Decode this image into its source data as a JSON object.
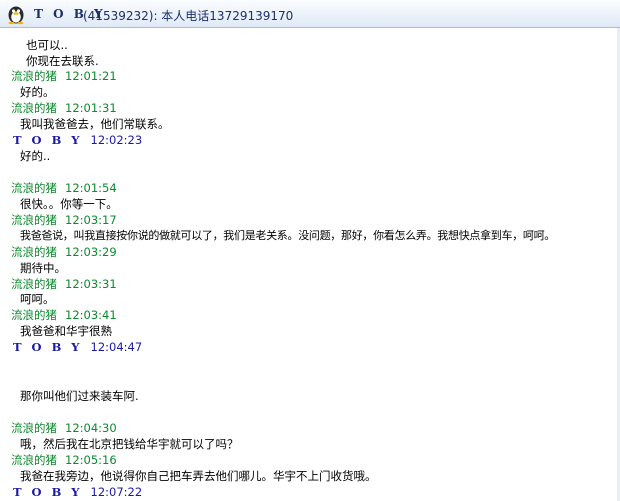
{
  "window": {
    "contact_name": "T O B Y",
    "contact_info": "(41539232): 本人电话13729139170"
  },
  "messages": [
    {
      "type": "text",
      "text": "也可以.."
    },
    {
      "type": "text",
      "text": "你现在去联系."
    },
    {
      "type": "header",
      "sender": "流浪的猪",
      "time": "12:01:21",
      "color": "green"
    },
    {
      "type": "text",
      "text": "好的。"
    },
    {
      "type": "header",
      "sender": "流浪的猪",
      "time": "12:01:31",
      "color": "green"
    },
    {
      "type": "text",
      "text": "我叫我爸爸去，他们常联系。"
    },
    {
      "type": "header",
      "sender": "T O B Y",
      "time": "12:02:23",
      "color": "blue"
    },
    {
      "type": "text",
      "text": "好的.."
    },
    {
      "type": "header",
      "sender": "流浪的猪",
      "time": "12:01:54",
      "color": "green"
    },
    {
      "type": "text",
      "text": "很快。。你等一下。"
    },
    {
      "type": "header",
      "sender": "流浪的猪",
      "time": "12:03:17",
      "color": "green"
    },
    {
      "type": "text",
      "text": "我爸爸说，叫我直接按你说的做就可以了，我们是老关系。没问题，那好，你看怎么弄。我想快点拿到车，呵呵。"
    },
    {
      "type": "header",
      "sender": "流浪的猪",
      "time": "12:03:29",
      "color": "green"
    },
    {
      "type": "text",
      "text": "期待中。"
    },
    {
      "type": "header",
      "sender": "流浪的猪",
      "time": "12:03:31",
      "color": "green"
    },
    {
      "type": "text",
      "text": "呵呵。"
    },
    {
      "type": "header",
      "sender": "流浪的猪",
      "time": "12:03:41",
      "color": "green"
    },
    {
      "type": "text",
      "text": "我爸爸和华宇很熟"
    },
    {
      "type": "header",
      "sender": "T O B Y",
      "time": "12:04:47",
      "color": "blue"
    },
    {
      "type": "text",
      "text": "那你叫他们过来装车阿."
    },
    {
      "type": "header",
      "sender": "流浪的猪",
      "time": "12:04:30",
      "color": "green"
    },
    {
      "type": "text",
      "text": "哦，然后我在北京把钱给华宇就可以了吗？"
    },
    {
      "type": "header",
      "sender": "流浪的猪",
      "time": "12:05:16",
      "color": "green"
    },
    {
      "type": "text",
      "text": "我爸在我旁边，他说得你自己把车弄去他们哪儿。华宇不上门收货哦。"
    },
    {
      "type": "header",
      "sender": "T O B Y",
      "time": "12:07:22",
      "color": "blue"
    }
  ]
}
